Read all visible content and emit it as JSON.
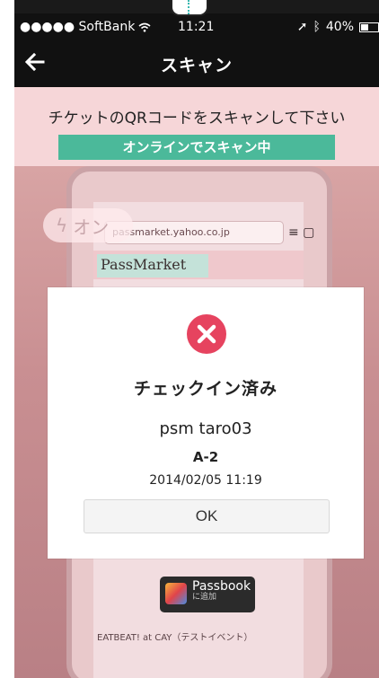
{
  "status_bar": {
    "carrier": "●●●●● SoftBank",
    "time": "11:21",
    "battery": "40%"
  },
  "nav": {
    "back_icon": "arrow-left-icon",
    "title": "スキャン"
  },
  "banner": {
    "instruction": "チケットのQRコードをスキャンして下さい",
    "status": "オンラインでスキャン中"
  },
  "camera": {
    "flash_label": "オン",
    "url": "passmarket.yahoo.co.jp",
    "logo": "PassMarket",
    "passbook_label": "Passbook",
    "passbook_sub": "に追加",
    "event_text": "EATBEAT! at CAY（テストイベント）"
  },
  "dialog": {
    "icon": "error-x-icon",
    "title": "チェックイン済み",
    "name": "psm taro03",
    "seat": "A-2",
    "datetime": "2014/02/05 11:19",
    "ok_label": "OK",
    "colors": {
      "error": "#e6435f",
      "badge": "#4bb99a",
      "banner": "#f6d6d8"
    }
  }
}
